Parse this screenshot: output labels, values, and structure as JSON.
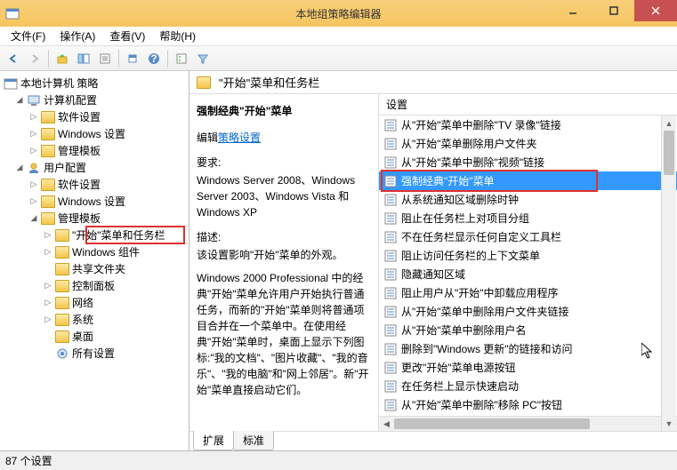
{
  "window": {
    "title": "本地组策略编辑器"
  },
  "menu": {
    "file": "文件(F)",
    "action": "操作(A)",
    "view": "查看(V)",
    "help": "帮助(H)"
  },
  "tree": {
    "root": "本地计算机 策略",
    "computer": "计算机配置",
    "computer_software": "软件设置",
    "computer_windows": "Windows 设置",
    "computer_templates": "管理模板",
    "user": "用户配置",
    "user_software": "软件设置",
    "user_windows": "Windows 设置",
    "user_templates": "管理模板",
    "start_menu": "\"开始\"菜单和任务栏",
    "windows_components": "Windows 组件",
    "shared_folders": "共享文件夹",
    "control_panel": "控制面板",
    "network": "网络",
    "system": "系统",
    "desktop": "桌面",
    "all_settings": "所有设置"
  },
  "header": {
    "title": "\"开始\"菜单和任务栏"
  },
  "detail": {
    "policy_title": "强制经典\"开始\"菜单",
    "edit_link": "策略设置",
    "edit_prefix": "编辑",
    "req_label": "要求:",
    "req_text": "Windows Server 2008、Windows Server 2003、Windows Vista 和 Windows XP",
    "desc_label": "描述:",
    "desc_text": "该设置影响\"开始\"菜单的外观。",
    "long_text": "Windows 2000 Professional 中的经典\"开始\"菜单允许用户开始执行普通任务，而新的\"开始\"菜单则将普通项目合并在一个菜单中。在使用经典\"开始\"菜单时，桌面上显示下列图标:\"我的文档\"、\"图片收藏\"、\"我的音乐\"、\"我的电脑\"和\"网上邻居\"。新\"开始\"菜单直接启动它们。"
  },
  "list": {
    "header": "设置",
    "items": [
      "从\"开始\"菜单中删除\"TV 录像\"链接",
      "从\"开始\"菜单删除用户文件夹",
      "从\"开始\"菜单中删除\"视频\"链接",
      "强制经典\"开始\"菜单",
      "从系统通知区域删除时钟",
      "阻止在任务栏上对项目分组",
      "不在任务栏显示任何自定义工具栏",
      "阻止访问任务栏的上下文菜单",
      "隐藏通知区域",
      "阻止用户从\"开始\"中卸载应用程序",
      "从\"开始\"菜单中删除用户文件夹链接",
      "从\"开始\"菜单中删除用户名",
      "删除到\"Windows 更新\"的链接和访问",
      "更改\"开始\"菜单电源按钮",
      "在任务栏上显示快速启动",
      "从\"开始\"菜单中删除\"移除 PC\"按钮"
    ]
  },
  "tabs": {
    "extended": "扩展",
    "standard": "标准"
  },
  "status": {
    "text": "87 个设置"
  }
}
